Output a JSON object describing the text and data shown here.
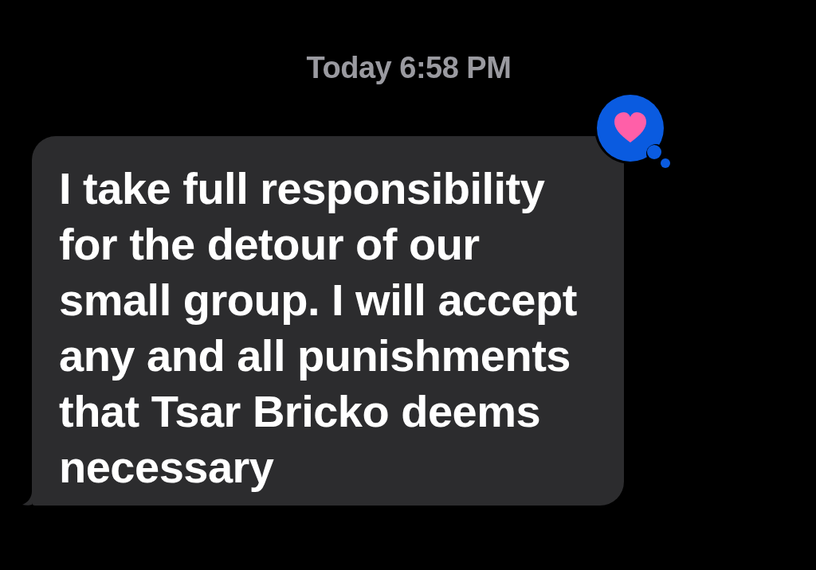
{
  "timestamp": "Today 6:58 PM",
  "message": {
    "text": "I take full responsibility for the detour of our small group. I will accept any and all punishments that Tsar Bricko deems necessary",
    "tapback": {
      "kind": "heart"
    }
  }
}
